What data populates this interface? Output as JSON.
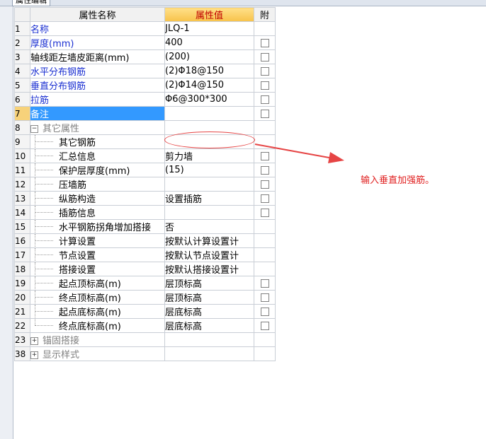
{
  "tab_title": "属性编辑",
  "columns": {
    "name": "属性名称",
    "value": "属性值",
    "attach": "附"
  },
  "rows": [
    {
      "num": "1",
      "name": "名称",
      "value": "JLQ-1",
      "style": "blue",
      "cb": false,
      "tree": "none"
    },
    {
      "num": "2",
      "name": "厚度(mm)",
      "value": "400",
      "style": "blue",
      "cb": true,
      "tree": "none"
    },
    {
      "num": "3",
      "name": "轴线距左墙皮距离(mm)",
      "value": "(200)",
      "style": "normal",
      "cb": true,
      "tree": "none"
    },
    {
      "num": "4",
      "name": "水平分布钢筋",
      "value": "(2)Φ18@150",
      "style": "blue",
      "cb": true,
      "tree": "none"
    },
    {
      "num": "5",
      "name": "垂直分布钢筋",
      "value": "(2)Φ14@150",
      "style": "blue",
      "cb": true,
      "tree": "none"
    },
    {
      "num": "6",
      "name": "拉筋",
      "value": "Φ6@300*300",
      "style": "blue",
      "cb": true,
      "tree": "none"
    },
    {
      "num": "7",
      "name": "备注",
      "value": "",
      "style": "sel",
      "cb": true,
      "tree": "none"
    },
    {
      "num": "8",
      "name": "其它属性",
      "value": "",
      "style": "gray",
      "cb": false,
      "tree": "minus"
    },
    {
      "num": "9",
      "name": "其它钢筋",
      "value": "",
      "style": "normal",
      "cb": false,
      "tree": "child"
    },
    {
      "num": "10",
      "name": "汇总信息",
      "value": "剪力墙",
      "style": "normal",
      "cb": true,
      "tree": "child"
    },
    {
      "num": "11",
      "name": "保护层厚度(mm)",
      "value": "(15)",
      "style": "normal",
      "cb": true,
      "tree": "child"
    },
    {
      "num": "12",
      "name": "压墙筋",
      "value": "",
      "style": "normal",
      "cb": true,
      "tree": "child"
    },
    {
      "num": "13",
      "name": "纵筋构造",
      "value": "设置插筋",
      "style": "normal",
      "cb": true,
      "tree": "child"
    },
    {
      "num": "14",
      "name": "插筋信息",
      "value": "",
      "style": "normal",
      "cb": true,
      "tree": "child"
    },
    {
      "num": "15",
      "name": "水平钢筋拐角增加搭接",
      "value": "否",
      "style": "normal",
      "cb": false,
      "tree": "child"
    },
    {
      "num": "16",
      "name": "计算设置",
      "value": "按默认计算设置计",
      "style": "normal",
      "cb": false,
      "tree": "child"
    },
    {
      "num": "17",
      "name": "节点设置",
      "value": "按默认节点设置计",
      "style": "normal",
      "cb": false,
      "tree": "child"
    },
    {
      "num": "18",
      "name": "搭接设置",
      "value": "按默认搭接设置计",
      "style": "normal",
      "cb": false,
      "tree": "child"
    },
    {
      "num": "19",
      "name": "起点顶标高(m)",
      "value": "层顶标高",
      "style": "normal",
      "cb": true,
      "tree": "child"
    },
    {
      "num": "20",
      "name": "终点顶标高(m)",
      "value": "层顶标高",
      "style": "normal",
      "cb": true,
      "tree": "child"
    },
    {
      "num": "21",
      "name": "起点底标高(m)",
      "value": "层底标高",
      "style": "normal",
      "cb": true,
      "tree": "child"
    },
    {
      "num": "22",
      "name": "终点底标高(m)",
      "value": "层底标高",
      "style": "normal",
      "cb": true,
      "tree": "last"
    },
    {
      "num": "23",
      "name": "锚固搭接",
      "value": "",
      "style": "gray",
      "cb": false,
      "tree": "plus"
    },
    {
      "num": "38",
      "name": "显示样式",
      "value": "",
      "style": "gray",
      "cb": false,
      "tree": "plus"
    }
  ],
  "annotation": {
    "text": "输入垂直加强筋。",
    "color": "#e02020"
  }
}
